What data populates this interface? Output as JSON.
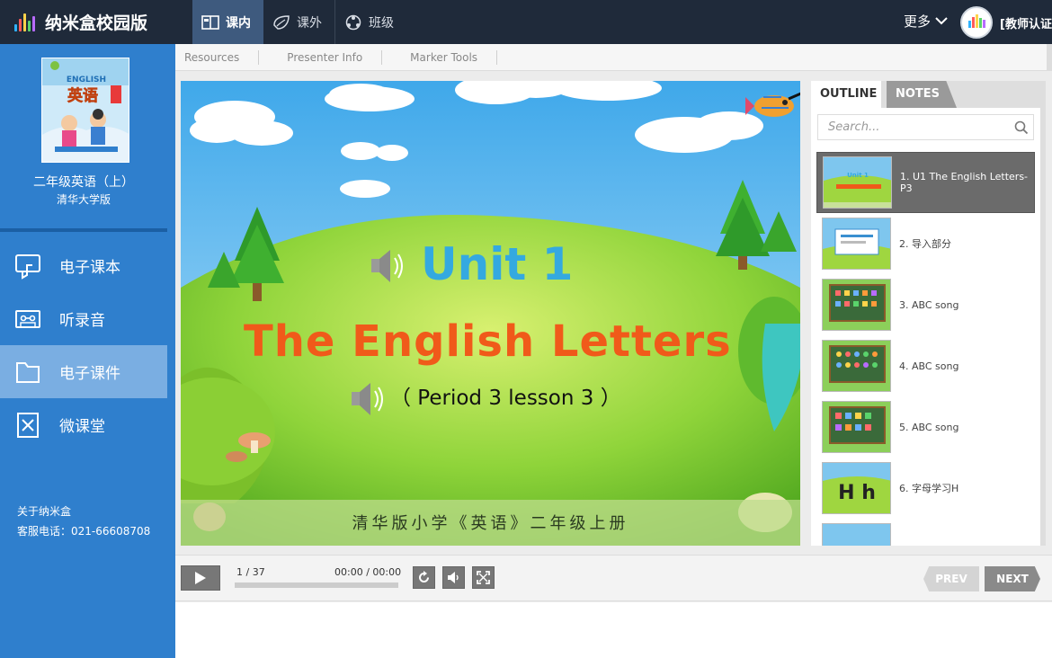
{
  "app": {
    "title": "纳米盒校园版"
  },
  "nav": {
    "items": [
      {
        "label": "课内",
        "icon": "book-open-icon",
        "active": true
      },
      {
        "label": "课外",
        "icon": "leaf-icon",
        "active": false
      },
      {
        "label": "班级",
        "icon": "group-icon",
        "active": false
      }
    ],
    "more_label": "更多",
    "user_label": "[教师认证"
  },
  "sidebar": {
    "book_title": "二年级英语（上）",
    "book_publisher": "清华大学版",
    "menu": [
      {
        "label": "电子课本",
        "icon": "thumb-book-icon",
        "active": false
      },
      {
        "label": "听录音",
        "icon": "cassette-icon",
        "active": false
      },
      {
        "label": "电子课件",
        "icon": "folder-icon",
        "active": true
      },
      {
        "label": "微课堂",
        "icon": "video-card-icon",
        "active": false
      }
    ],
    "footer": {
      "about": "关于纳米盒",
      "service": "客服电话：021-66608708"
    }
  },
  "subtabs": [
    "Resources",
    "Presenter Info",
    "Marker Tools"
  ],
  "slide": {
    "unit": "Unit 1",
    "title": "The English Letters",
    "period": "（ Period 3 lesson 3 ）",
    "footer": "清华版小学《英语》二年级上册",
    "cover_english": "ENGLISH",
    "cover_chinese": "英语"
  },
  "outline_panel": {
    "tabs": [
      "OUTLINE",
      "NOTES"
    ],
    "search_placeholder": "Search...",
    "items": [
      {
        "label": "1. U1 The English Letters-P3",
        "active": true,
        "thumb_text": "Unit 1"
      },
      {
        "label": "2. 导入部分",
        "active": false,
        "thumb_text": ""
      },
      {
        "label": "3. ABC song",
        "active": false,
        "thumb_text": ""
      },
      {
        "label": "4. ABC song",
        "active": false,
        "thumb_text": ""
      },
      {
        "label": "5. ABC song",
        "active": false,
        "thumb_text": ""
      },
      {
        "label": "6. 字母学习H",
        "active": false,
        "thumb_text": "H h"
      },
      {
        "label": "",
        "active": false,
        "thumb_text": ""
      }
    ]
  },
  "controls": {
    "page_indicator": "1 / 37",
    "time": "00:00 / 00:00",
    "progress": 0.0,
    "prev_label": "PREV",
    "next_label": "NEXT"
  },
  "colors": {
    "topbar": "#1f2a3a",
    "sidebar": "#2f7fcd",
    "unit_text": "#34a9e0",
    "title_text": "#f05a1a"
  }
}
